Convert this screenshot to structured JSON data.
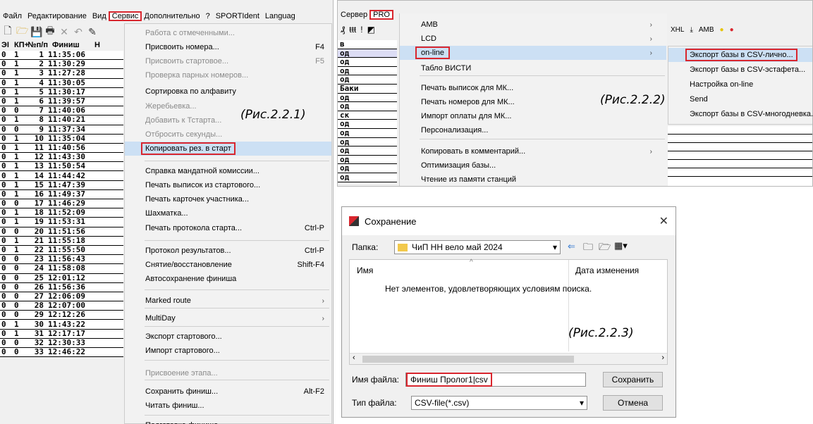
{
  "panel1": {
    "menubar": [
      "Файл",
      "Редактирование",
      "Вид",
      "Сервис",
      "Дополнительно",
      "?",
      "SPORTIdent",
      "Languag"
    ],
    "active_menu": "Сервис",
    "toolbar_icons": [
      "new-file-icon",
      "open-folder-icon",
      "save-icon",
      "print-icon",
      "delete-icon",
      "undo-icon",
      "edit-icon"
    ],
    "table_header": [
      "ЭI",
      "КП+",
      "№п/п",
      "Финиш",
      "Н"
    ],
    "rows": [
      [
        "0",
        "1",
        "1",
        "11:35:06"
      ],
      [
        "0",
        "1",
        "2",
        "11:30:29"
      ],
      [
        "0",
        "1",
        "3",
        "11:27:28"
      ],
      [
        "0",
        "1",
        "4",
        "11:30:05"
      ],
      [
        "0",
        "1",
        "5",
        "11:30:17"
      ],
      [
        "0",
        "1",
        "6",
        "11:39:57"
      ],
      [
        "0",
        "0",
        "7",
        "11:40:06"
      ],
      [
        "0",
        "1",
        "8",
        "11:40:21"
      ],
      [
        "0",
        "0",
        "9",
        "11:37:34"
      ],
      [
        "0",
        "1",
        "10",
        "11:35:04"
      ],
      [
        "0",
        "1",
        "11",
        "11:40:56"
      ],
      [
        "0",
        "1",
        "12",
        "11:43:30"
      ],
      [
        "0",
        "1",
        "13",
        "11:50:54"
      ],
      [
        "0",
        "1",
        "14",
        "11:44:42"
      ],
      [
        "0",
        "1",
        "15",
        "11:47:39"
      ],
      [
        "0",
        "1",
        "16",
        "11:49:37"
      ],
      [
        "0",
        "0",
        "17",
        "11:46:29"
      ],
      [
        "0",
        "1",
        "18",
        "11:52:09"
      ],
      [
        "0",
        "1",
        "19",
        "11:53:31"
      ],
      [
        "0",
        "0",
        "20",
        "11:51:56"
      ],
      [
        "0",
        "1",
        "21",
        "11:55:18"
      ],
      [
        "0",
        "1",
        "22",
        "11:55:50"
      ],
      [
        "0",
        "0",
        "23",
        "11:56:43"
      ],
      [
        "0",
        "0",
        "24",
        "11:58:08"
      ],
      [
        "0",
        "0",
        "25",
        "12:01:12"
      ],
      [
        "0",
        "0",
        "26",
        "11:56:36"
      ],
      [
        "0",
        "0",
        "27",
        "12:06:09"
      ],
      [
        "0",
        "0",
        "28",
        "12:07:00"
      ],
      [
        "0",
        "0",
        "29",
        "12:12:26"
      ],
      [
        "0",
        "1",
        "30",
        "11:43:22"
      ],
      [
        "0",
        "1",
        "31",
        "12:17:17"
      ],
      [
        "0",
        "0",
        "32",
        "12:30:33"
      ],
      [
        "0",
        "0",
        "33",
        "12:46:22"
      ]
    ],
    "menu": [
      {
        "label": "Работа с отмеченными...",
        "shortcut": "",
        "disabled": true
      },
      {
        "label": "Присвоить номера...",
        "shortcut": "F4",
        "disabled": false
      },
      {
        "label": "Присвоить стартовое...",
        "shortcut": "F5",
        "disabled": true
      },
      {
        "label": "Проверка парных номеров...",
        "shortcut": "",
        "disabled": true
      },
      {
        "label": "Сортировка по алфавиту",
        "shortcut": "",
        "disabled": false
      },
      {
        "label": "Жеребьевка...",
        "shortcut": "",
        "disabled": true
      },
      {
        "label": "Добавить к Тстарта...",
        "shortcut": "",
        "disabled": true
      },
      {
        "label": "Отбросить секунды...",
        "shortcut": "",
        "disabled": true
      },
      {
        "label": "Копировать рез. в старт",
        "shortcut": "",
        "disabled": false,
        "highlight": true
      },
      {
        "label": "Справка мандатной комиссии...",
        "shortcut": "",
        "disabled": false
      },
      {
        "label": "Печать выписок из стартового...",
        "shortcut": "",
        "disabled": false
      },
      {
        "label": "Печать карточек участника...",
        "shortcut": "",
        "disabled": false
      },
      {
        "label": "Шахматка...",
        "shortcut": "",
        "disabled": false
      },
      {
        "label": "Печать протокола старта...",
        "shortcut": "Ctrl-P",
        "disabled": false
      },
      {
        "label": "Протокол результатов...",
        "shortcut": "Ctrl-P",
        "disabled": false
      },
      {
        "label": "Снятие/восстановление",
        "shortcut": "Shift-F4",
        "disabled": false
      },
      {
        "label": "Автосохранение финиша",
        "shortcut": "",
        "disabled": false
      },
      {
        "label": "Marked route",
        "shortcut": "›",
        "disabled": false
      },
      {
        "label": "MultiDay",
        "shortcut": "›",
        "disabled": false
      },
      {
        "label": "Экспорт стартового...",
        "shortcut": "",
        "disabled": false
      },
      {
        "label": "Импорт стартового...",
        "shortcut": "",
        "disabled": false
      },
      {
        "label": "Присвоение этапа...",
        "shortcut": "",
        "disabled": true
      },
      {
        "label": "Сохранить финиш...",
        "shortcut": "Alt-F2",
        "disabled": false
      },
      {
        "label": "Читать финиш...",
        "shortcut": "",
        "disabled": false
      },
      {
        "label": "Подготовка финиша...",
        "shortcut": "",
        "disabled": false
      }
    ],
    "caption": "(Рис.2.2.1)"
  },
  "panel2": {
    "menubar": [
      "Сервер",
      "PRO"
    ],
    "active_menu": "PRO",
    "toolbar_glyphs": [
      "₰",
      "ŧŧŧ",
      "!",
      "◩"
    ],
    "list": [
      "в",
      "од",
      "од",
      "од",
      "од",
      "Баки",
      "од",
      "од",
      "ск",
      "од",
      "од",
      "од",
      "од",
      "од",
      "од",
      "од"
    ],
    "menu": [
      {
        "label": "AMB",
        "arrow": "›"
      },
      {
        "label": "LCD",
        "arrow": "›"
      },
      {
        "label": "on-line",
        "arrow": "›",
        "highlight": true
      },
      {
        "label": "Табло ВИСТИ",
        "arrow": ""
      },
      {
        "label": "Печать выписок для МК...",
        "arrow": ""
      },
      {
        "label": "Печать номеров для МК...",
        "arrow": ""
      },
      {
        "label": "Импорт оплаты для МК...",
        "arrow": ""
      },
      {
        "label": "Персонализация...",
        "arrow": ""
      },
      {
        "label": "Копировать в комментарий...",
        "arrow": "›"
      },
      {
        "label": "Оптимизация базы...",
        "arrow": ""
      },
      {
        "label": "Чтение из памяти станций",
        "arrow": ""
      }
    ],
    "toolbar_right": [
      "XHL",
      "AMB"
    ],
    "submenu": [
      {
        "label": "Экспорт базы в CSV-лично...",
        "highlight": true
      },
      {
        "label": "Экспорт базы в CSV-эстафета..."
      },
      {
        "label": "Настройка on-line"
      },
      {
        "label": "Send"
      },
      {
        "label": "Экспорт базы в CSV-многодневка..."
      }
    ],
    "caption": "(Рис.2.2.2)"
  },
  "dialog": {
    "title": "Сохранение",
    "folder_label": "Папка:",
    "folder_value": "ЧиП НН вело май 2024",
    "column_name": "Имя",
    "column_date": "Дата изменения",
    "empty_message": "Нет элементов, удовлетворяющих условиям поиска.",
    "filename_label": "Имя файла:",
    "filename_value": "Финиш Пролог1|csv",
    "filetype_label": "Тип файла:",
    "filetype_value": "CSV-file(*.csv)",
    "save_button": "Сохранить",
    "cancel_button": "Отмена",
    "caption": "(Рис.2.2.3)"
  }
}
